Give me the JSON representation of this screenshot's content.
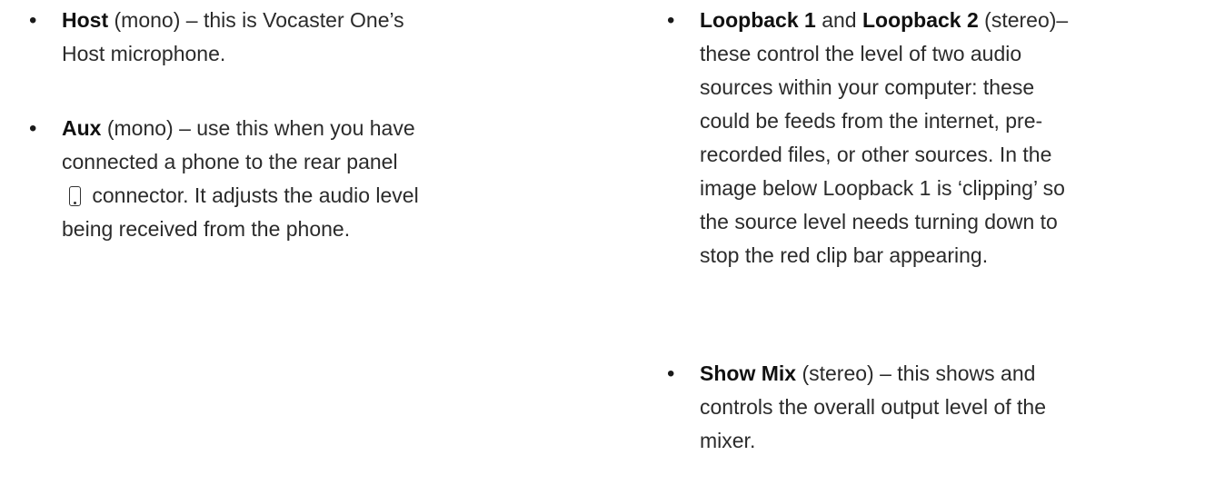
{
  "left_column": {
    "host": {
      "name": "Host",
      "qualifier": " (mono) – this is Vocaster One’s",
      "line2": "Host microphone."
    },
    "aux": {
      "name": "Aux",
      "qualifier": " (mono)  – use this when you have",
      "line2": "connected a phone to the rear panel",
      "line3_after_icon": " connector. It adjusts the audio level",
      "line4": "being received from the phone.",
      "icon": "phone-icon"
    }
  },
  "right_column": {
    "loopback": {
      "name1": "Loopback 1",
      "and": " and ",
      "name2": "Loopback 2",
      "qualifier": " (stereo)–",
      "lines": [
        "these control the level of two audio",
        "sources within your computer: these",
        "could be feeds from the internet, pre-",
        "recorded files, or other sources. In the",
        "image below Loopback 1 is ‘clipping’ so",
        "the source level needs turning down to",
        "stop the red clip bar appearing."
      ]
    },
    "show_mix": {
      "name": "Show Mix",
      "qualifier": " (stereo) – this shows and",
      "lines": [
        "controls the overall output level of the",
        "mixer."
      ]
    }
  },
  "bullet_glyph": "•"
}
